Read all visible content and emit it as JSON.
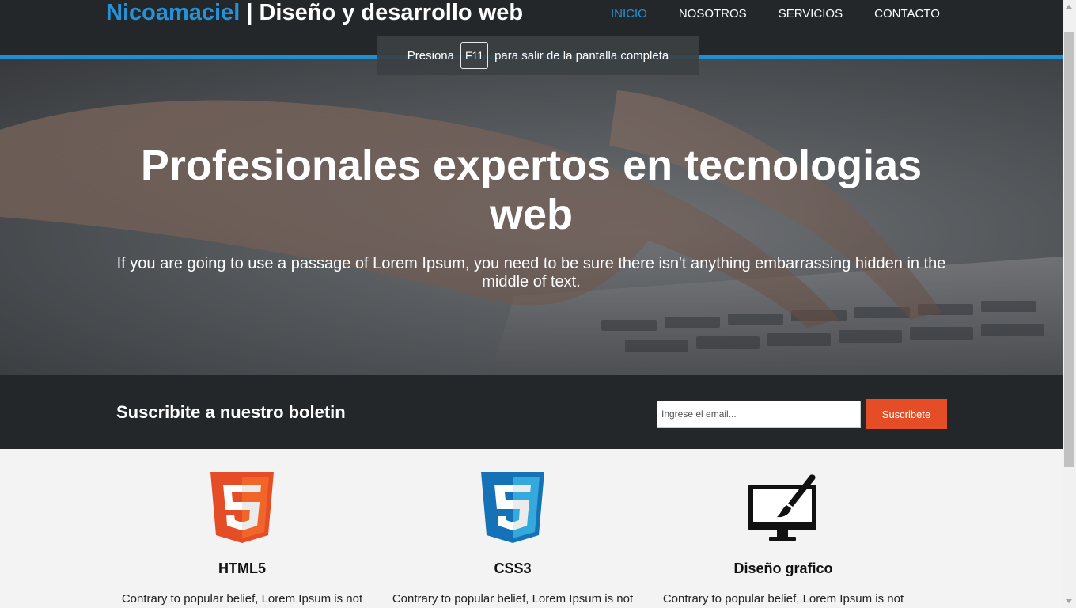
{
  "header": {
    "brand_accent": "Nicoamaciel",
    "brand_rest": " | Diseño y desarrollo web",
    "nav": [
      {
        "label": "INICIO",
        "active": true
      },
      {
        "label": "NOSOTROS",
        "active": false
      },
      {
        "label": "SERVICIOS",
        "active": false
      },
      {
        "label": "CONTACTO",
        "active": false
      }
    ]
  },
  "toast": {
    "before": "Presiona",
    "key": "F11",
    "after": "para salir de la pantalla completa"
  },
  "hero": {
    "title": "Profesionales expertos en tecnologias web",
    "subtitle": "If you are going to use a passage of Lorem Ipsum, you need to be sure there isn't anything embarrassing hidden in the middle of text."
  },
  "newsletter": {
    "title": "Suscribite a nuestro boletin",
    "input_placeholder": "Ingrese el email...",
    "button_label": "Suscribete"
  },
  "services": [
    {
      "icon": "html5-icon",
      "title": "HTML5",
      "text": "Contrary to popular belief, Lorem Ipsum is not simply random text. It has roots in a piece of"
    },
    {
      "icon": "css3-icon",
      "title": "CSS3",
      "text": "Contrary to popular belief, Lorem Ipsum is not simply random text. It has roots in a piece of"
    },
    {
      "icon": "monitor-brush-icon",
      "title": "Diseño grafico",
      "text": "Contrary to popular belief, Lorem Ipsum is not simply random text. It has roots in a piece of"
    }
  ],
  "colors": {
    "accent_blue": "#2492d9",
    "header_bg": "#232729",
    "button_orange": "#e44d26",
    "html5_orange": "#e44d26",
    "css3_blue": "#1572b6"
  }
}
